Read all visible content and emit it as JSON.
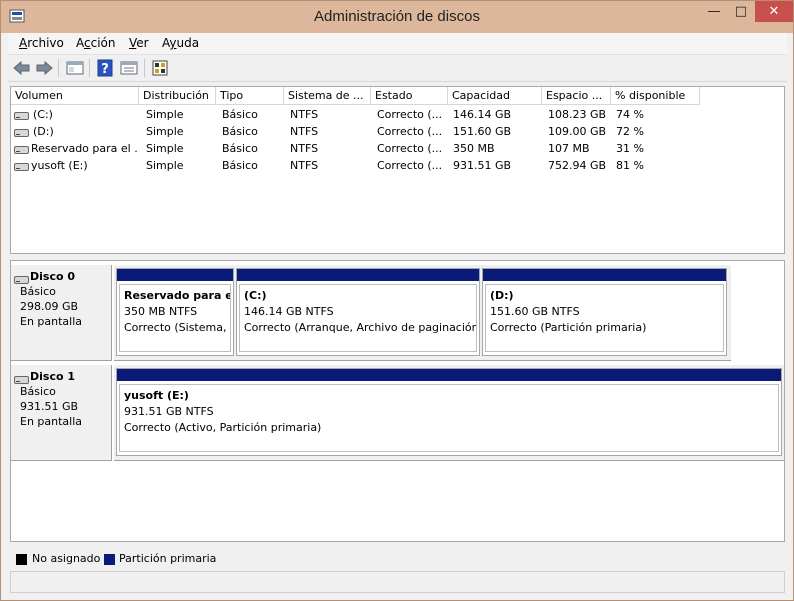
{
  "window": {
    "title": "Administración de discos",
    "controls": {
      "minimize": "—",
      "maximize": "□",
      "close": "✕"
    }
  },
  "menu": [
    {
      "label": "Archivo",
      "accel": "A",
      "rest": "rchivo"
    },
    {
      "label": "Acción",
      "accel": "c",
      "pre": "A",
      "rest": "ción"
    },
    {
      "label": "Ver",
      "accel": "V",
      "rest": "er"
    },
    {
      "label": "Ayuda",
      "accel": "y",
      "pre": "A",
      "rest": "uda"
    }
  ],
  "toolbar": {
    "icons": [
      "back-icon",
      "forward-icon",
      "console-tree-icon",
      "help-icon",
      "properties-icon",
      "settings-icon"
    ]
  },
  "volume_list": {
    "columns": [
      "Volumen",
      "Distribución",
      "Tipo",
      "Sistema de ...",
      "Estado",
      "Capacidad",
      "Espacio ...",
      "% disponible"
    ],
    "rows": [
      [
        "(C:)",
        "Simple",
        "Básico",
        "NTFS",
        "Correcto (...",
        "146.14 GB",
        "108.23 GB",
        "74 %"
      ],
      [
        "(D:)",
        "Simple",
        "Básico",
        "NTFS",
        "Correcto (...",
        "151.60 GB",
        "109.00 GB",
        "72 %"
      ],
      [
        "Reservado para el ...",
        "Simple",
        "Básico",
        "NTFS",
        "Correcto (...",
        "350 MB",
        "107 MB",
        "31 %"
      ],
      [
        "yusoft  (E:)",
        "Simple",
        "Básico",
        "NTFS",
        "Correcto (...",
        "931.51 GB",
        "752.94 GB",
        "81 %"
      ]
    ]
  },
  "disks": [
    {
      "name": "Disco 0",
      "type": "Básico",
      "size": "298.09 GB",
      "status": "En pantalla",
      "partitions": [
        {
          "name": "Reservado para el s",
          "size": "350 MB NTFS",
          "status": "Correcto (Sistema, A"
        },
        {
          "name": " (C:)",
          "size": "146.14 GB NTFS",
          "status": "Correcto (Arranque, Archivo de paginación,"
        },
        {
          "name": " (D:)",
          "size": "151.60 GB NTFS",
          "status": "Correcto (Partición primaria)"
        }
      ]
    },
    {
      "name": "Disco 1",
      "type": "Básico",
      "size": "931.51 GB",
      "status": "En pantalla",
      "partitions": [
        {
          "name": "yusoft  (E:)",
          "size": "931.51 GB NTFS",
          "status": "Correcto (Activo, Partición primaria)"
        }
      ]
    }
  ],
  "legend": [
    {
      "label": "No asignado",
      "color": "#000000"
    },
    {
      "label": "Partición primaria",
      "color": "#0a1a78"
    }
  ],
  "colors": {
    "titlebar": "#dcb79b",
    "partition_primary": "#0a1a78",
    "close_button": "#c7504c"
  }
}
